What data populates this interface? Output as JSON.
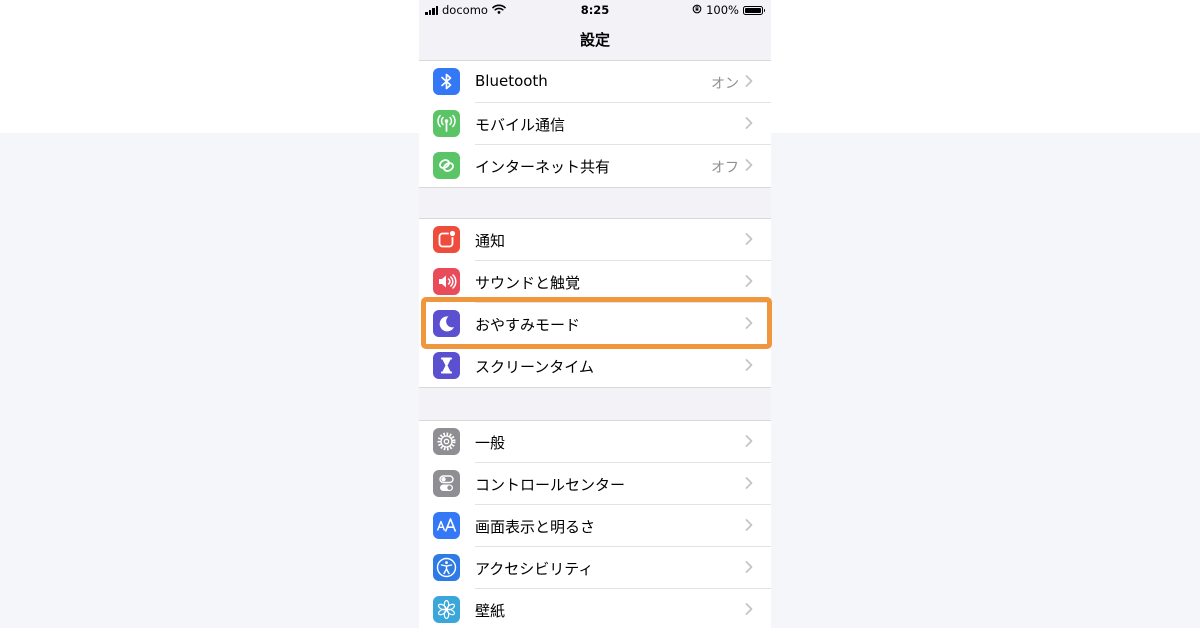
{
  "status_bar": {
    "carrier": "docomo",
    "time": "8:25",
    "battery_percent": "100%",
    "battery_level": 1.0,
    "icons": [
      "signal-icon",
      "wifi-icon",
      "orientation-lock-icon",
      "battery-icon"
    ]
  },
  "header": {
    "title": "設定"
  },
  "colors": {
    "highlight": "#f0963c",
    "bluetooth": "#3478f6",
    "cellular": "#5ac466",
    "hotspot": "#5ac466",
    "notifications": "#ee4d3d",
    "sounds": "#e94b5b",
    "do_not_disturb": "#5a50d0",
    "screen_time": "#5a50d0",
    "general": "#8e8e93",
    "control_center": "#8e8e93",
    "display": "#3478f6",
    "accessibility": "#2f7be5",
    "wallpaper": "#3aa7d8"
  },
  "groups": [
    {
      "items": [
        {
          "label": "Bluetooth",
          "value": "オン",
          "icon": "bluetooth-icon"
        },
        {
          "label": "モバイル通信",
          "value": "",
          "icon": "antenna-icon"
        },
        {
          "label": "インターネット共有",
          "value": "オフ",
          "icon": "link-icon"
        }
      ]
    },
    {
      "items": [
        {
          "label": "通知",
          "value": "",
          "icon": "notification-icon"
        },
        {
          "label": "サウンドと触覚",
          "value": "",
          "icon": "speaker-icon"
        },
        {
          "label": "おやすみモード",
          "value": "",
          "icon": "moon-icon",
          "highlighted": true
        },
        {
          "label": "スクリーンタイム",
          "value": "",
          "icon": "hourglass-icon"
        }
      ]
    },
    {
      "items": [
        {
          "label": "一般",
          "value": "",
          "icon": "gear-icon"
        },
        {
          "label": "コントロールセンター",
          "value": "",
          "icon": "toggles-icon"
        },
        {
          "label": "画面表示と明るさ",
          "value": "",
          "icon": "text-size-icon"
        },
        {
          "label": "アクセシビリティ",
          "value": "",
          "icon": "accessibility-icon"
        },
        {
          "label": "壁紙",
          "value": "",
          "icon": "flower-icon"
        }
      ]
    }
  ]
}
